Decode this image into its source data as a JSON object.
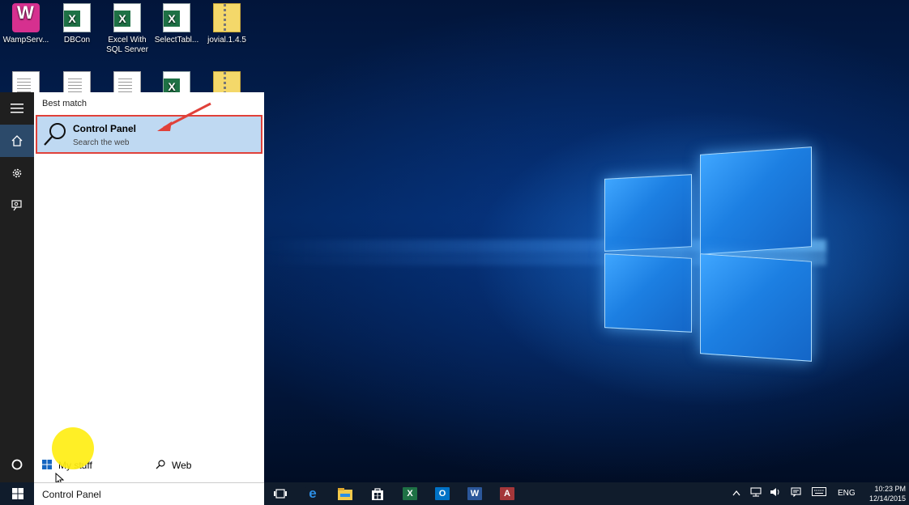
{
  "desktop": {
    "icons": [
      {
        "label": "WampServ...",
        "icon": "wampserver-icon"
      },
      {
        "label": "DBCon",
        "icon": "excel-file-icon"
      },
      {
        "label": "Excel With SQL Server",
        "icon": "excel-file-icon"
      },
      {
        "label": "SelectTabl...",
        "icon": "excel-file-icon"
      },
      {
        "label": "jovial.1.4.5",
        "icon": "zip-folder-icon"
      }
    ],
    "second_row_icons": [
      "text-file-icon",
      "document-icon",
      "document-icon",
      "excel-file-icon",
      "zip-folder-icon"
    ]
  },
  "start_menu": {
    "rail": [
      "hamburger-icon",
      "home-icon",
      "settings-icon",
      "feedback-icon",
      "cortana-icon"
    ],
    "best_match_label": "Best match",
    "result": {
      "title": "Control Panel",
      "subtitle": "Search the web",
      "icon": "search-icon"
    },
    "scopes": {
      "my_stuff": "My stuff",
      "web": "Web"
    }
  },
  "taskbar": {
    "search_text": "Control Panel",
    "apps": [
      {
        "name": "task-view-icon",
        "letter": "",
        "color": "#101c2c"
      },
      {
        "name": "edge-icon",
        "letter": "e",
        "color": "#1e88e5"
      },
      {
        "name": "file-explorer-icon",
        "letter": "",
        "color": "#f2c94c"
      },
      {
        "name": "store-icon",
        "letter": "",
        "color": "#ffffff"
      },
      {
        "name": "excel-icon",
        "letter": "X",
        "color": "#1e7145"
      },
      {
        "name": "outlook-icon",
        "letter": "O",
        "color": "#0072c6"
      },
      {
        "name": "word-icon",
        "letter": "W",
        "color": "#2b579a"
      },
      {
        "name": "access-icon",
        "letter": "A",
        "color": "#a4373a"
      }
    ],
    "tray": {
      "language": "ENG",
      "time": "10:23 PM",
      "date": "12/14/2015"
    }
  }
}
